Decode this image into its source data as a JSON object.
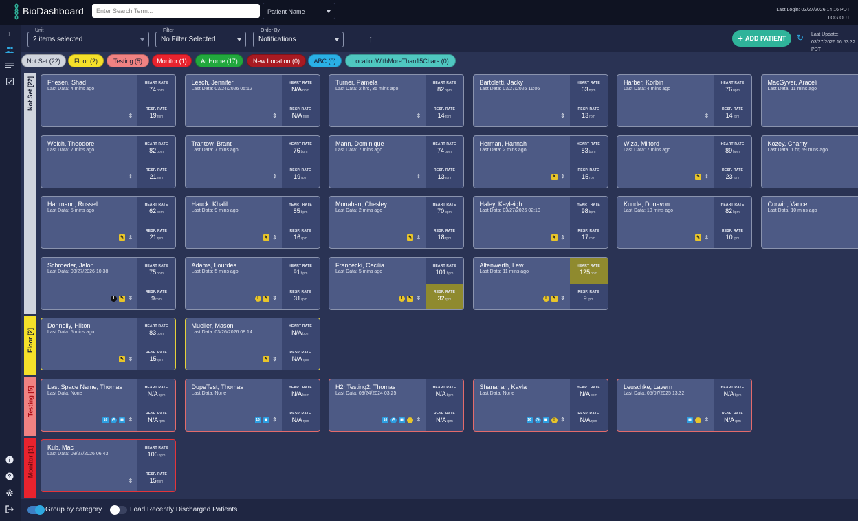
{
  "app": {
    "title": "BioDashboard"
  },
  "header": {
    "search_placeholder": "Enter Search Term...",
    "search_type": "Patient Name",
    "last_login": "Last Login: 03/27/2026 14:16 PDT",
    "logout": "LOG OUT"
  },
  "filters": {
    "unit": {
      "label": "Unit",
      "value": "2 items selected"
    },
    "filter": {
      "label": "Filter",
      "value": "No Filter Selected"
    },
    "order": {
      "label": "Order By",
      "value": "Notifications"
    },
    "add_patient": "ADD PATIENT",
    "last_update_label": "Last Update:",
    "last_update_value": "03/27/2026 16:53:32 PDT"
  },
  "chips": [
    {
      "label": "Not Set (22)",
      "color": "#d0d4dd",
      "text": "#1a1f33"
    },
    {
      "label": "Floor (2)",
      "color": "#f5e02a",
      "text": "#1a1f33"
    },
    {
      "label": "Testing (5)",
      "color": "#f08282",
      "text": "#1a1f33"
    },
    {
      "label": "Monitor (1)",
      "color": "#e8232e",
      "text": "#ffffff"
    },
    {
      "label": "At Home (17)",
      "color": "#21a83d",
      "text": "#ffffff"
    },
    {
      "label": "New Location (0)",
      "color": "#a81a22",
      "text": "#ffffff"
    },
    {
      "label": "ABC (0)",
      "color": "#2ab0e6",
      "text": "#1a1f33"
    },
    {
      "label": "LocationWithMoreThan15Chars (0)",
      "color": "#4fc7c0",
      "text": "#1a1f33"
    }
  ],
  "categories": [
    {
      "label": "Not Set [22]",
      "color": "#d0d4dd",
      "text": "#1a1f33"
    },
    {
      "label": "Floor [2]",
      "color": "#f5e02a",
      "text": "#1a1f33"
    },
    {
      "label": "Testing [5]",
      "color": "#f08282",
      "text": "#b0121a"
    },
    {
      "label": "Monitor [1]",
      "color": "#e8232e",
      "text": "#6e0a0f"
    }
  ],
  "vitals_labels": {
    "hr": "HEART RATE",
    "rr": "RESP. RATE",
    "hr_unit": "bpm",
    "rr_unit": "rpm"
  },
  "patients": [
    {
      "name": "Friesen, Shad",
      "last": "Last Data: 4 mins ago",
      "hr": "74",
      "rr": "19",
      "icons": []
    },
    {
      "name": "Lesch, Jennifer",
      "last": "Last Data: 03/24/2026 05:12",
      "hr": "N/A",
      "rr": "N/A",
      "icons": []
    },
    {
      "name": "Turner, Pamela",
      "last": "Last Data: 2 hrs, 35 mins ago",
      "hr": "82",
      "rr": "14",
      "icons": []
    },
    {
      "name": "Bartoletti, Jacky",
      "last": "Last Data: 03/27/2026 11:06",
      "hr": "63",
      "rr": "13",
      "icons": []
    },
    {
      "name": "Harber, Korbin",
      "last": "Last Data: 4 mins ago",
      "hr": "76",
      "rr": "14",
      "icons": []
    },
    {
      "name": "MacGyver, Araceli",
      "last": "Last Data: 11 mins ago",
      "hr": "",
      "rr": "",
      "icons": []
    },
    {
      "name": "Welch, Theodore",
      "last": "Last Data: 7 mins ago",
      "hr": "82",
      "rr": "21",
      "icons": []
    },
    {
      "name": "Trantow, Brant",
      "last": "Last Data: 7 mins ago",
      "hr": "76",
      "rr": "19",
      "icons": []
    },
    {
      "name": "Mann, Dominique",
      "last": "Last Data: 7 mins ago",
      "hr": "74",
      "rr": "13",
      "icons": []
    },
    {
      "name": "Herman, Hannah",
      "last": "Last Data: 2 mins ago",
      "hr": "83",
      "rr": "15",
      "icons": [
        "note"
      ]
    },
    {
      "name": "Wiza, Milford",
      "last": "Last Data: 7 mins ago",
      "hr": "89",
      "rr": "23",
      "icons": [
        "note"
      ]
    },
    {
      "name": "Kozey, Charity",
      "last": "Last Data: 1 hr, 59 mins ago",
      "hr": "",
      "rr": "",
      "icons": [
        "note"
      ]
    },
    {
      "name": "Hartmann, Russell",
      "last": "Last Data: 5 mins ago",
      "hr": "62",
      "rr": "21",
      "icons": [
        "note"
      ]
    },
    {
      "name": "Hauck, Khalil",
      "last": "Last Data: 9 mins ago",
      "hr": "85",
      "rr": "16",
      "icons": [
        "note"
      ]
    },
    {
      "name": "Monahan, Chesley",
      "last": "Last Data: 2 mins ago",
      "hr": "70",
      "rr": "18",
      "icons": [
        "note"
      ]
    },
    {
      "name": "Haley, Kayleigh",
      "last": "Last Data: 03/27/2026 02:10",
      "hr": "98",
      "rr": "17",
      "icons": [
        "note"
      ]
    },
    {
      "name": "Kunde, Donavon",
      "last": "Last Data: 10 mins ago",
      "hr": "82",
      "rr": "10",
      "icons": [
        "note"
      ]
    },
    {
      "name": "Corwin, Vance",
      "last": "Last Data: 10 mins ago",
      "hr": "",
      "rr": "",
      "icons": [
        "wrench",
        "note"
      ]
    },
    {
      "name": "Schroeder, Jalon",
      "last": "Last Data: 03/27/2026 10:38",
      "hr": "75",
      "rr": "9",
      "icons": [
        "warn-dark",
        "note"
      ]
    },
    {
      "name": "Adams, Lourdes",
      "last": "Last Data: 5 mins ago",
      "hr": "91",
      "rr": "31",
      "icons": [
        "warn",
        "note"
      ]
    },
    {
      "name": "Francecki, Cecilia",
      "last": "Last Data: 5 mins ago",
      "hr": "101",
      "rr": "32",
      "icons": [
        "warn",
        "note"
      ],
      "rr_alert": true
    },
    {
      "name": "Altenwerth, Lew",
      "last": "Last Data: 11 mins ago",
      "hr": "125",
      "rr": "9",
      "icons": [
        "warn",
        "note"
      ],
      "hr_alert": true
    },
    {
      "name": "Donnelly, Hilton",
      "last": "Last Data: 5 mins ago",
      "hr": "83",
      "rr": "15",
      "icons": [
        "note"
      ]
    },
    {
      "name": "Mueller, Mason",
      "last": "Last Data: 03/26/2026 08:14",
      "hr": "N/A",
      "rr": "N/A",
      "icons": [
        "note"
      ]
    },
    {
      "name": "Last Space Name, Thomas",
      "last": "Last Data: None",
      "hr": "N/A",
      "rr": "N/A",
      "icons": [
        "cal",
        "clock",
        "dev"
      ]
    },
    {
      "name": "DupeTest, Thomas",
      "last": "Last Data: None",
      "hr": "N/A",
      "rr": "N/A",
      "icons": [
        "cal",
        "dev"
      ]
    },
    {
      "name": "H2hTesting2, Thomas",
      "last": "Last Data: 09/24/2024 03:25",
      "hr": "N/A",
      "rr": "N/A",
      "icons": [
        "cal",
        "clock",
        "dev",
        "warn"
      ]
    },
    {
      "name": "Shanahan, Kayla",
      "last": "Last Data: None",
      "hr": "N/A",
      "rr": "N/A",
      "icons": [
        "cal",
        "clock",
        "dev",
        "warn"
      ]
    },
    {
      "name": "Leuschke, Lavern",
      "last": "Last Data: 05/07/2025 13:32",
      "hr": "N/A",
      "rr": "N/A",
      "icons": [
        "dev",
        "warn"
      ]
    },
    {
      "name": "Kub, Mac",
      "last": "Last Data: 03/27/2026 06:43",
      "hr": "106",
      "rr": "15",
      "icons": []
    }
  ],
  "bottom": {
    "group_by": "Group by category",
    "load_discharged": "Load Recently Discharged Patients"
  }
}
